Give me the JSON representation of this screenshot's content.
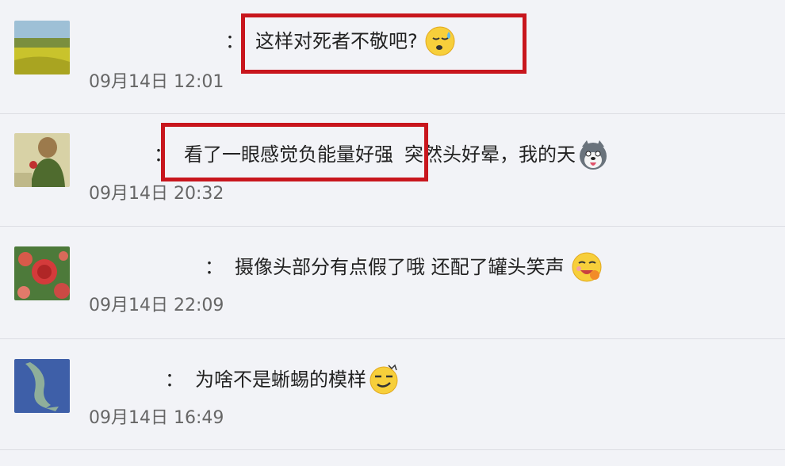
{
  "comments": [
    {
      "separator": "：",
      "text": "这样对死者不敬吧?",
      "text2": "",
      "time": "09月14日 12:01",
      "emoji": "sweat-face"
    },
    {
      "separator": "：",
      "text": "看了一眼感觉负能量好强",
      "text2": "突然头好晕，我的天",
      "time": "09月14日 20:32",
      "emoji": "husky-face"
    },
    {
      "separator": "：",
      "text": "摄像头部分有点假了哦 还配了罐头笑声",
      "text2": "",
      "time": "09月14日 22:09",
      "emoji": "hungry-face"
    },
    {
      "separator": "：",
      "text": "为啥不是蜥蜴的模样",
      "text2": "",
      "time": "09月14日 16:49",
      "emoji": "smirk-face"
    }
  ],
  "colors": {
    "highlight_box": "#c8161d",
    "background": "#f2f3f7"
  }
}
